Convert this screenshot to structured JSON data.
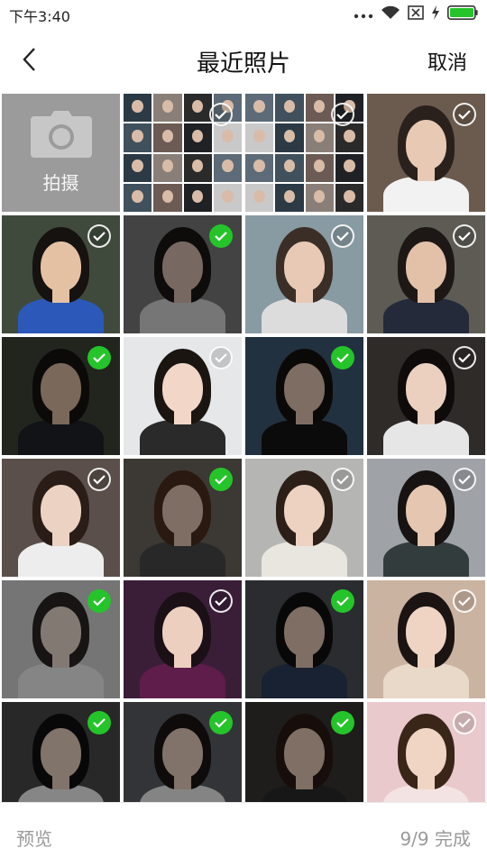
{
  "status_bar": {
    "time": "下午3:40"
  },
  "header": {
    "title": "最近照片",
    "cancel_label": "取消"
  },
  "camera_tile": {
    "label": "拍摄"
  },
  "photos": [
    {
      "selected": false,
      "bg": "#3d4a55",
      "collage": true
    },
    {
      "selected": false,
      "bg": "#3d4a55",
      "collage": true
    },
    {
      "selected": false,
      "bg": "#6b5a4e",
      "skin": "#e8c9b4",
      "hair": "#2a211d",
      "shirt": "#f2f2f2"
    },
    {
      "selected": false,
      "bg": "#404a3c",
      "skin": "#e5c1a4",
      "hair": "#15120f",
      "shirt": "#2c59b9"
    },
    {
      "selected": true,
      "bg": "#7a7a7a",
      "skin": "#d9c0b3",
      "hair": "#1a1614",
      "shirt": "#d8d8d8"
    },
    {
      "selected": false,
      "bg": "#889aa2",
      "skin": "#e8c9b6",
      "hair": "#3a2e27",
      "shirt": "#dcdcdc"
    },
    {
      "selected": false,
      "bg": "#5d5b54",
      "skin": "#e3c0a8",
      "hair": "#1d1816",
      "shirt": "#242a3a"
    },
    {
      "selected": true,
      "bg": "#3c4438",
      "skin": "#dfbea4",
      "hair": "#171311",
      "shirt": "#1f2429"
    },
    {
      "selected": false,
      "bg": "#e6e7e9",
      "skin": "#f2d7c9",
      "hair": "#1b1512",
      "shirt": "#2a2a2a"
    },
    {
      "selected": true,
      "bg": "#3f5a74",
      "skin": "#e6c7b4",
      "hair": "#15110f",
      "shirt": "#141414"
    },
    {
      "selected": false,
      "bg": "#2f2b29",
      "skin": "#ecd0bf",
      "hair": "#0e0b0a",
      "shirt": "#e6e6e6"
    },
    {
      "selected": false,
      "bg": "#5a4f4a",
      "skin": "#ecd2c2",
      "hair": "#2a1c16",
      "shirt": "#ededed"
    },
    {
      "selected": true,
      "bg": "#6e6660",
      "skin": "#e7c8b4",
      "hair": "#4b2f1f",
      "shirt": "#4a4a4a"
    },
    {
      "selected": false,
      "bg": "#b5b6b3",
      "skin": "#edd2c1",
      "hair": "#2c1f18",
      "shirt": "#e9e6e0"
    },
    {
      "selected": false,
      "bg": "#9fa3a8",
      "skin": "#e5c6b1",
      "hair": "#171312",
      "shirt": "#333c3c"
    },
    {
      "selected": true,
      "bg": "#d6d6d6",
      "skin": "#eeddd2",
      "hair": "#2a2523",
      "shirt": "#f2f2f2"
    },
    {
      "selected": false,
      "bg": "#3a1e38",
      "skin": "#edcfc0",
      "hair": "#1a1016",
      "shirt": "#5e1d4a"
    },
    {
      "selected": true,
      "bg": "#4d5157",
      "skin": "#e6c8b6",
      "hair": "#121011",
      "shirt": "#2f3f5c"
    },
    {
      "selected": false,
      "bg": "#cbb3a1",
      "skin": "#efd4c4",
      "hair": "#1b1412",
      "shirt": "#e8d9c8"
    },
    {
      "selected": true,
      "bg": "#4a4a4a",
      "skin": "#ecd3c3",
      "hair": "#121011",
      "shirt": "#f5f5f5"
    },
    {
      "selected": true,
      "bg": "#5d6066",
      "skin": "#ecd2c2",
      "hair": "#1a1413",
      "shirt": "#f0f0f0"
    },
    {
      "selected": true,
      "bg": "#3a3533",
      "skin": "#e8cbb8",
      "hair": "#2a1b15",
      "shirt": "#2b2b2b"
    },
    {
      "selected": false,
      "bg": "#e9c9cc",
      "skin": "#f0d5c5",
      "hair": "#3a2519",
      "shirt": "#f3e3e2"
    }
  ],
  "footer": {
    "preview_label": "预览",
    "done_label": "9/9 完成"
  },
  "colors": {
    "accent_selected": "#25c42a",
    "disabled_text": "#9a9a9a"
  }
}
